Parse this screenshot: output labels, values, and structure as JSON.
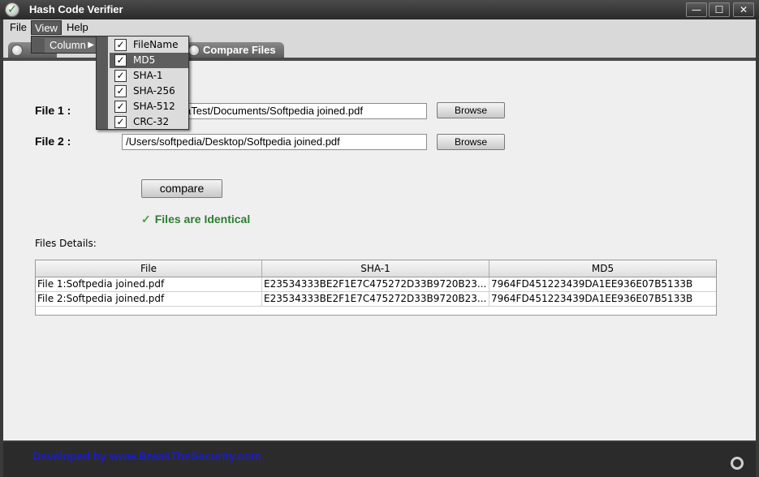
{
  "window": {
    "title": "Hash Code Verifier",
    "controls": {
      "minimize": "—",
      "maximize": "☐",
      "close": "✕"
    }
  },
  "menubar": {
    "items": [
      {
        "label": "File"
      },
      {
        "label": "View"
      },
      {
        "label": "Help"
      }
    ]
  },
  "view_menu": {
    "column_label": "Column",
    "columns": [
      {
        "label": "FileName",
        "checked": true
      },
      {
        "label": "MD5",
        "checked": true
      },
      {
        "label": "SHA-1",
        "checked": true
      },
      {
        "label": "SHA-256",
        "checked": true
      },
      {
        "label": "SHA-512",
        "checked": true
      },
      {
        "label": "CRC-32",
        "checked": true
      }
    ]
  },
  "tabs": [
    {
      "label": ""
    },
    {
      "label": "Compare Files"
    }
  ],
  "form": {
    "file1_label": "File 1 :",
    "file1_value": "nge/SoftpediaTest/Documents/Softpedia joined.pdf",
    "file2_label": "File 2 :",
    "file2_value": "/Users/softpedia/Desktop/Softpedia joined.pdf",
    "browse_label": "Browse",
    "compare_label": "compare"
  },
  "result": {
    "status_text": "Files are Identical",
    "details_label": "Files Details:"
  },
  "table": {
    "headers": [
      "File",
      "SHA-1",
      "MD5"
    ],
    "rows": [
      [
        "File 1:Softpedia joined.pdf",
        "E23534333BE2F1E7C475272D33B9720B23...",
        "7964FD451223439DA1EE936E07B5133B"
      ],
      [
        "File 2:Softpedia joined.pdf",
        "E23534333BE2F1E7C475272D33B9720B23...",
        "7964FD451223439DA1EE936E07B5133B"
      ]
    ]
  },
  "footer": {
    "credit": "Developed by www.BreakTheSecurity.com"
  },
  "colors": {
    "status_green": "#2e7d32",
    "footer_link": "#1c1cc8",
    "chrome_dark": "#3a3a3a"
  }
}
